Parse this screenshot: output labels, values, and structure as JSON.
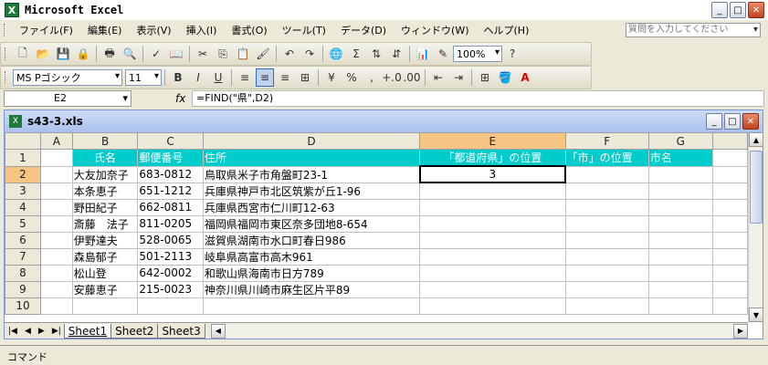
{
  "title": "Microsoft Excel",
  "menu": [
    "ファイル(F)",
    "編集(E)",
    "表示(V)",
    "挿入(I)",
    "書式(O)",
    "ツール(T)",
    "データ(D)",
    "ウィンドウ(W)",
    "ヘルプ(H)"
  ],
  "help_placeholder": "質問を入力してください",
  "toolbar": {
    "zoom": "100%",
    "font": "MS Pゴシック",
    "size": "11",
    "bold": "B",
    "italic": "I",
    "underline": "U",
    "percent": "%",
    "comma": ",",
    "sigma": "Σ"
  },
  "formula": {
    "name": "E2",
    "fx": "fx",
    "value": "=FIND(\"県\",D2)"
  },
  "workbook": {
    "name": "s43-3.xls"
  },
  "columns": [
    "A",
    "B",
    "C",
    "D",
    "E",
    "F",
    "G"
  ],
  "headers": {
    "b": "氏名",
    "c": "郵便番号",
    "d": "住所",
    "e": "「都道府県」の位置",
    "f": "「市」の位置",
    "g": "市名"
  },
  "rows": [
    {
      "n": "1"
    },
    {
      "n": "2",
      "b": "大友加奈子",
      "c": "683-0812",
      "d": "鳥取県米子市角盤町23-1",
      "e": "3"
    },
    {
      "n": "3",
      "b": "本条恵子",
      "c": "651-1212",
      "d": "兵庫県神戸市北区筑紫が丘1-96"
    },
    {
      "n": "4",
      "b": "野田紀子",
      "c": "662-0811",
      "d": "兵庫県西宮市仁川町12-63"
    },
    {
      "n": "5",
      "b": "斎藤　法子",
      "c": "811-0205",
      "d": "福岡県福岡市東区奈多団地8-654"
    },
    {
      "n": "6",
      "b": "伊野達夫",
      "c": "528-0065",
      "d": "滋賀県湖南市水口町春日986"
    },
    {
      "n": "7",
      "b": "森島郁子",
      "c": "501-2113",
      "d": "岐阜県高富市高木961"
    },
    {
      "n": "8",
      "b": "松山登",
      "c": "642-0002",
      "d": "和歌山県海南市日方789"
    },
    {
      "n": "9",
      "b": "安藤恵子",
      "c": "215-0023",
      "d": "神奈川県川崎市麻生区片平89"
    },
    {
      "n": "10"
    }
  ],
  "sheets": [
    "Sheet1",
    "Sheet2",
    "Sheet3"
  ],
  "status": "コマンド"
}
